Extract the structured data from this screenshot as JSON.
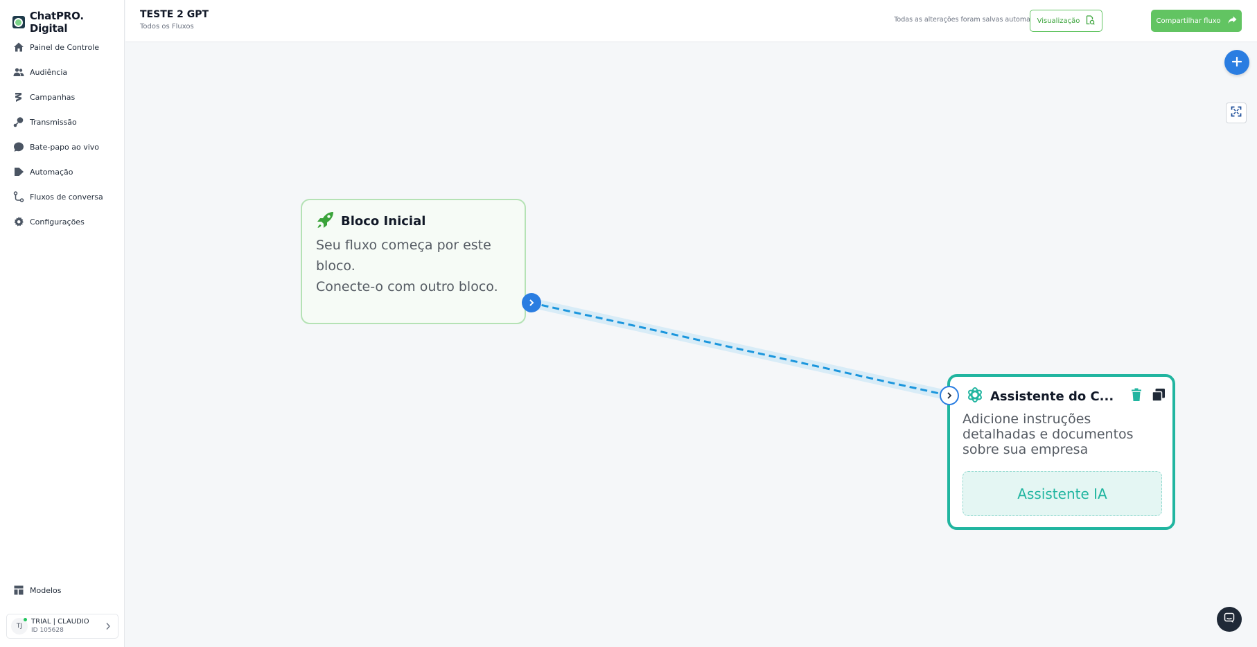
{
  "brand": {
    "name": "ChatPRO. Digital"
  },
  "sidebar": {
    "items": [
      {
        "label": "Painel de Controle",
        "icon": "home-icon"
      },
      {
        "label": "Audiência",
        "icon": "users-icon"
      },
      {
        "label": "Campanhas",
        "icon": "campaign-icon"
      },
      {
        "label": "Transmissão",
        "icon": "broadcast-icon"
      },
      {
        "label": "Bate-papo ao vivo",
        "icon": "chat-icon"
      },
      {
        "label": "Automação",
        "icon": "automation-icon"
      },
      {
        "label": "Fluxos de conversa",
        "icon": "flow-icon"
      },
      {
        "label": "Configurações",
        "icon": "gear-icon"
      }
    ],
    "bottom_item": {
      "label": "Modelos",
      "icon": "templates-icon"
    },
    "user": {
      "initials": "TJ",
      "name": "TRIAL | CLAUDIO",
      "id": "ID 105628"
    }
  },
  "header": {
    "title": "TESTE 2 GPT",
    "breadcrumb": "Todos os Fluxos",
    "autosave_status": "Todas as alterações foram salvas automaticamente",
    "preview_label": "Visualização",
    "share_label": "Compartilhar fluxo"
  },
  "canvas": {
    "start_node": {
      "title": "Bloco Inicial",
      "description_line1": "Seu fluxo começa por este bloco.",
      "description_line2": "Conecte-o com outro bloco."
    },
    "ai_node": {
      "title": "Assistente do C...",
      "description": "Adicione instruções detalhadas e documentos sobre sua empresa",
      "action_label": "Assistente IA"
    }
  },
  "colors": {
    "accent_green": "#62c462",
    "accent_blue": "#2a7de1",
    "accent_teal": "#21b5a0"
  }
}
